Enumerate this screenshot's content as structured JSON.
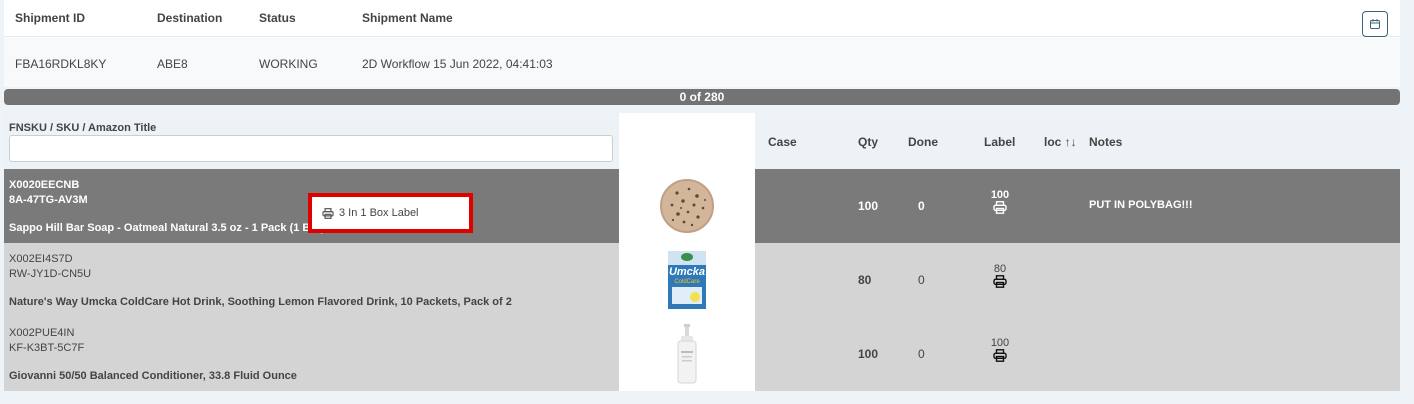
{
  "shipment": {
    "headers": [
      "Shipment ID",
      "Destination",
      "Status",
      "Shipment Name"
    ],
    "id": "FBA16RDKL8KY",
    "destination": "ABE8",
    "status": "WORKING",
    "name": "2D Workflow 15 Jun 2022, 04:41:03"
  },
  "progress": {
    "text": "0 of 280",
    "fraction": 0
  },
  "items_table": {
    "filter_label": "FNSKU / SKU / Amazon Title",
    "filter_value": "",
    "columns": {
      "case": "Case",
      "qty": "Qty",
      "done": "Done",
      "label": "Label",
      "loc": "loc ↑↓",
      "notes": "Notes"
    },
    "rows": [
      {
        "fnsku": "X0020EECNB",
        "sku": "8A-47TG-AV3M",
        "title": "Sappo Hill Bar Soap - Oatmeal Natural 3.5 oz - 1 Pack (1 Bar)",
        "image": "soap-bar",
        "qty": "100",
        "done": "0",
        "label": "100",
        "notes": "PUT IN POLYBAG!!!"
      },
      {
        "fnsku": "X002EI4S7D",
        "sku": "RW-JY1D-CN5U",
        "title": "Nature's Way Umcka ColdCare Hot Drink, Soothing Lemon Flavored Drink, 10 Packets, Pack of 2",
        "image": "umcka-box",
        "image_text": "Umcka",
        "image_subtext": "ColdCare",
        "qty": "80",
        "done": "0",
        "label": "80",
        "notes": ""
      },
      {
        "fnsku": "X002PUE4IN",
        "sku": "KF-K3BT-5C7F",
        "title": "Giovanni 50/50 Balanced Conditioner, 33.8 Fluid Ounce",
        "image": "pump-bottle",
        "qty": "100",
        "done": "0",
        "label": "100",
        "notes": ""
      }
    ]
  },
  "tooltip": {
    "text": "3 In 1 Box Label",
    "icon": "printer-icon"
  },
  "colors": {
    "progress_bg": "#737373",
    "active_row": "#7a7a7a",
    "inactive_row": "#d4d4d4",
    "highlight": "#e00000"
  }
}
